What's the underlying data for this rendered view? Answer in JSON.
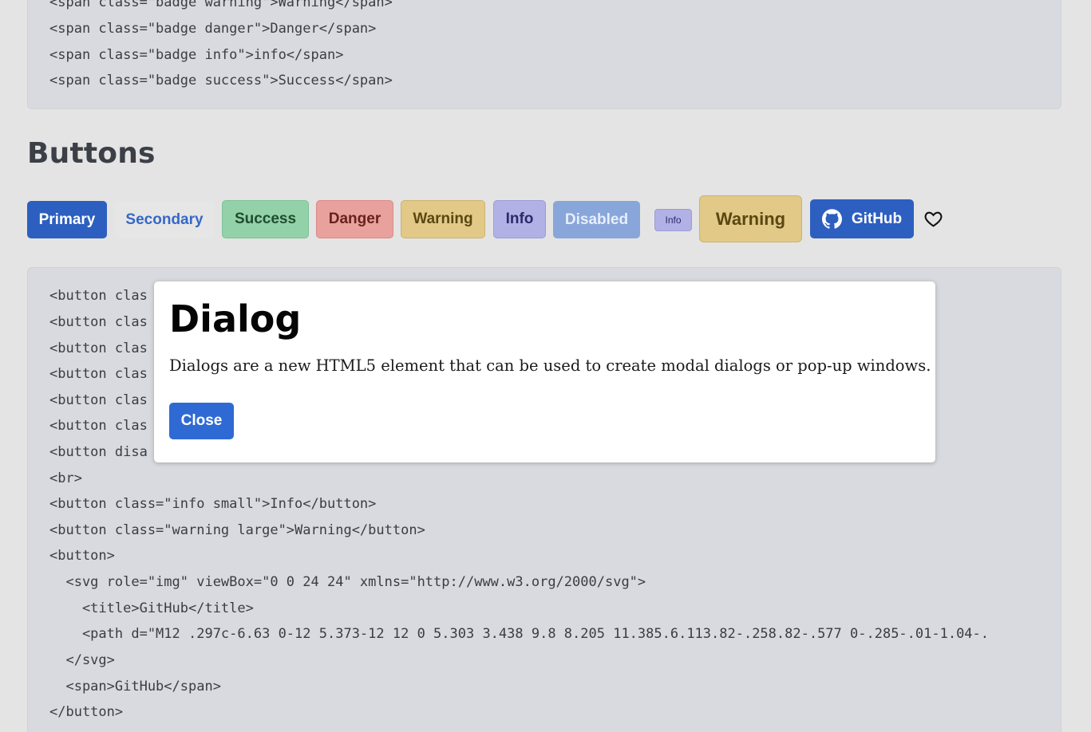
{
  "code_top": {
    "lines": [
      "<span class=\"badge warning\">Warning</span>",
      "<span class=\"badge danger\">Danger</span>",
      "<span class=\"badge info\">info</span>",
      "<span class=\"badge success\">Success</span>"
    ]
  },
  "buttons_section": {
    "title": "Buttons",
    "buttons": {
      "primary": "Primary",
      "secondary": "Secondary",
      "success": "Success",
      "danger": "Danger",
      "warning": "Warning",
      "info": "Info",
      "disabled": "Disabled",
      "info_small": "Info",
      "warning_large": "Warning",
      "github": "GitHub"
    },
    "icons": {
      "github": "github-icon",
      "heart": "heart-icon"
    }
  },
  "code_bottom": {
    "lines": [
      "<button clas",
      "<button clas",
      "<button clas",
      "<button clas",
      "<button clas",
      "<button clas",
      "<button disa",
      "<br>",
      "<button class=\"info small\">Info</button>",
      "<button class=\"warning large\">Warning</button>",
      "<button>",
      "  <svg role=\"img\" viewBox=\"0 0 24 24\" xmlns=\"http://www.w3.org/2000/svg\">",
      "    <title>GitHub</title>",
      "    <path d=\"M12 .297c-6.63 0-12 5.373-12 12 0 5.303 3.438 9.8 8.205 11.385.6.113.82-.258.82-.577 0-.285-.01-1.04-.",
      "  </svg>",
      "  <span>GitHub</span>",
      "</button>"
    ]
  },
  "dialog": {
    "title": "Dialog",
    "text": "Dialogs are a new HTML5 element that can be used to create modal dialogs or pop-up windows.",
    "close_label": "Close"
  },
  "colors": {
    "background": "#e4e4e4",
    "code_bg": "#d8dadf",
    "primary": "#2c5fbf",
    "success": "#93d1a9",
    "danger": "#e8a19c",
    "warning": "#e2c987",
    "info": "#b2b1e6",
    "disabled": "#88a6d9"
  }
}
